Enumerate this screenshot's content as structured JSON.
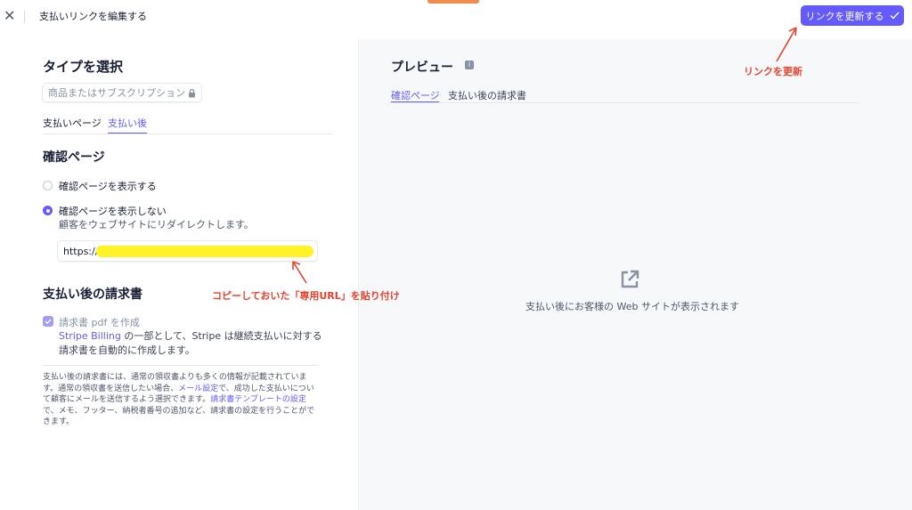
{
  "header": {
    "close_symbol": "✕",
    "title": "支払いリンクを編集する",
    "update_button": "リンクを更新する",
    "update_icon": "check-icon"
  },
  "colors": {
    "accent": "#635bff",
    "annotation": "#e8432e",
    "highlight": "#fff227"
  },
  "left": {
    "type_heading": "タイプを選択",
    "product_placeholder": "商品またはサブスクリプション",
    "tabs": [
      {
        "label": "支払いページ",
        "active": false
      },
      {
        "label": "支払い後",
        "active": true
      }
    ],
    "confirm_heading": "確認ページ",
    "options": [
      {
        "label": "確認ページを表示する",
        "selected": false
      },
      {
        "label": "確認ページを表示しない",
        "selected": true,
        "sub": "顧客をウェブサイトにリダイレクトします。"
      }
    ],
    "url_prefix": "https://",
    "invoice_heading": "支払い後の請求書",
    "invoice_checkbox": "請求書 pdf を作成",
    "stripe_link": "Stripe Billing",
    "stripe_text_1": " の一部として、Stripe は継続支払いに対する",
    "stripe_text_2": "請求書を自動的に作成します。",
    "note": {
      "p1": "支払い後の請求書には、通常の領収書よりも多くの情報が記載されています。通常の領収書を送信したい場合、",
      "link1": "メール設定",
      "p2": "で、成功した支払いについて顧客にメールを送信するよう選択できます。",
      "link2": "請求書テンプレートの設定",
      "p3": "で、メモ、フッター、納税者番号の追加など、請求書の設定を行うことができます。"
    }
  },
  "right": {
    "preview_heading": "プレビュー",
    "info_symbol": "i",
    "tabs": [
      {
        "label": "確認ページ",
        "active": true
      },
      {
        "label": "支払い後の請求書",
        "active": false
      }
    ],
    "external_icon": "external-link-icon",
    "preview_message": "支払い後にお客様の Web サイトが表示されます"
  },
  "annotations": {
    "update_note": "リンクを更新",
    "paste_note": "コピーしておいた「専用URL」を貼り付け"
  }
}
